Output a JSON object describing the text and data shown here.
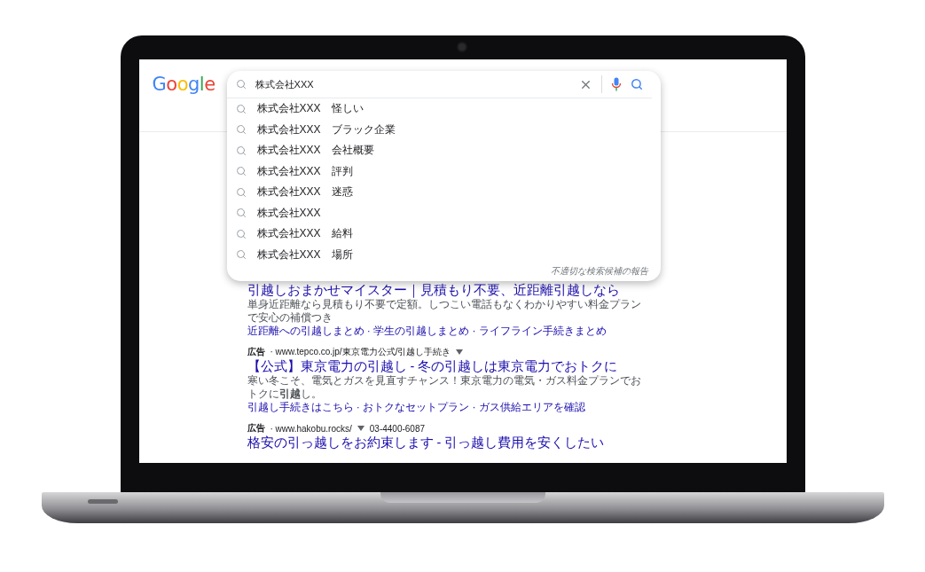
{
  "logo": "Google",
  "search": {
    "value": "株式会社XXX",
    "suggestions": [
      "株式会社XXX　怪しい",
      "株式会社XXX　ブラック企業",
      "株式会社XXX　会社概要",
      "株式会社XXX　評判",
      "株式会社XXX　迷惑",
      "株式会社XXX",
      "株式会社XXX　給料",
      "株式会社XXX　場所"
    ],
    "report_link": "不適切な検索候補の報告"
  },
  "results": [
    {
      "title": "引越しおまかせマイスター｜見積もり不要、近距離引越しなら",
      "snippet": "単身近距離なら見積もり不要で定額。しつこい電話もなくわかりやすい料金プランで安心の補償つき",
      "sitelinks": "近距離への引越しまとめ · 学生の引越しまとめ · ライフライン手続きまとめ"
    },
    {
      "ad_label": "広告",
      "url": "· www.tepco.co.jp/東京電力公式/引越し手続き",
      "title": "【公式】東京電力の引越し - 冬の引越しは東京電力でおトクに",
      "snippet": "寒い冬こそ、電気とガスを見直すチャンス！東京電力の電気・ガス料金プランでおトクに**引越**し。",
      "sitelinks": "引越し手続きはこちら · おトクなセットプラン · ガス供給エリアを確認"
    },
    {
      "ad_label": "広告",
      "url": "· www.hakobu.rocks/",
      "phone": "03-4400-6087",
      "title": "格安の引っ越しをお約束します - 引っ越し費用を安くしたい"
    }
  ]
}
